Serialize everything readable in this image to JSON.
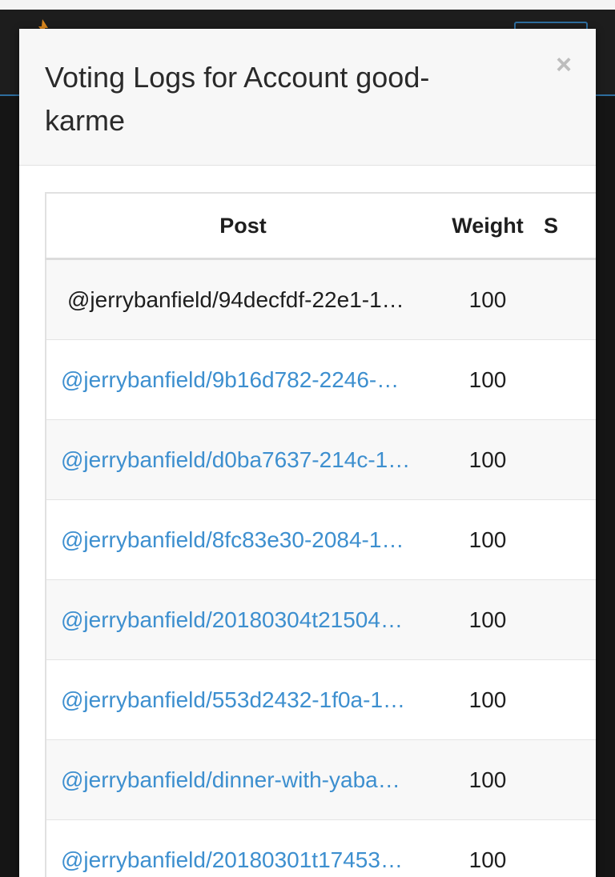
{
  "modal": {
    "title": "Voting Logs for Account good-karme",
    "close_label": "×"
  },
  "table": {
    "headers": {
      "post": "Post",
      "weight": "Weight",
      "extra": "S"
    },
    "rows": [
      {
        "post": "@jerrybanfield/94decfdf-22e1-1…",
        "weight": "100",
        "linked": false
      },
      {
        "post": "@jerrybanfield/9b16d782-2246-…",
        "weight": "100",
        "linked": true
      },
      {
        "post": "@jerrybanfield/d0ba7637-214c-1…",
        "weight": "100",
        "linked": true
      },
      {
        "post": "@jerrybanfield/8fc83e30-2084-1…",
        "weight": "100",
        "linked": true
      },
      {
        "post": "@jerrybanfield/20180304t21504…",
        "weight": "100",
        "linked": true
      },
      {
        "post": "@jerrybanfield/553d2432-1f0a-1…",
        "weight": "100",
        "linked": true
      },
      {
        "post": "@jerrybanfield/dinner-with-yaba…",
        "weight": "100",
        "linked": true
      },
      {
        "post": "@jerrybanfield/20180301t17453…",
        "weight": "100",
        "linked": true
      }
    ]
  },
  "colors": {
    "link": "#3d8fcf",
    "backdrop": "#151515",
    "accent": "#2e6d9e"
  }
}
